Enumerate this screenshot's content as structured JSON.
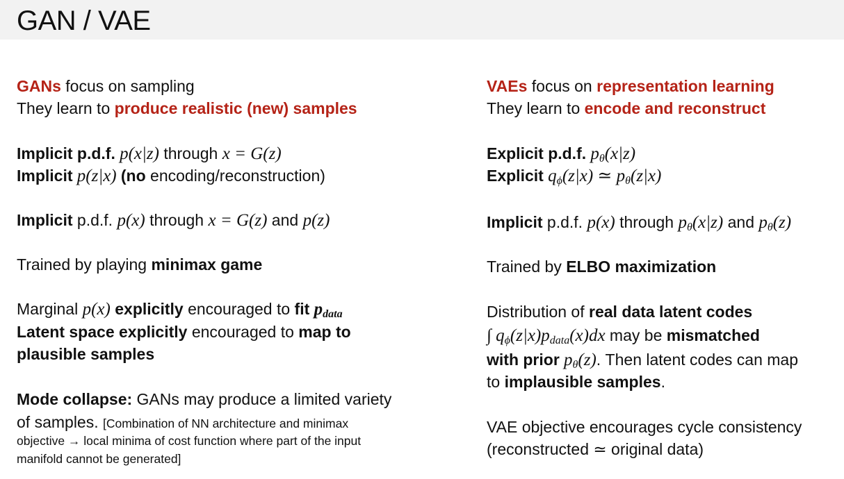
{
  "title": "GAN / VAE",
  "colors": {
    "accent": "#b52317",
    "title_bar": "#f2f2f2",
    "text": "#111111"
  },
  "gan": {
    "l1": {
      "a": "GANs",
      "b": " focus on sampling"
    },
    "l2": {
      "a": "They learn to ",
      "b": "produce realistic (new) samples"
    },
    "l3": {
      "a": "Implicit p.d.f.",
      "b": " p(x|z)",
      "c": " through ",
      "d": "x = G(z)"
    },
    "l4": {
      "a": "Implicit",
      "b": " p(z|x) ",
      "c": "(",
      "d": "no",
      "e": " encoding/reconstruction)"
    },
    "l5": {
      "a": "Implicit",
      "b": " p.d.f. ",
      "c": "p(x)",
      "d": " through ",
      "e": "x = G(z)",
      "f": " and ",
      "g": "p(z)"
    },
    "l6": {
      "a": "Trained by playing ",
      "b": "minimax game"
    },
    "l7": {
      "a": "Marginal ",
      "b": "p(x)",
      "c": " explicitly",
      "d": " encouraged to ",
      "e": "fit ",
      "f": "p",
      "g": "data"
    },
    "l8": {
      "a": "Latent space explicitly",
      "b": " encouraged to ",
      "c": "map to"
    },
    "l9": {
      "a": "plausible samples"
    },
    "l10": {
      "a": "Mode collapse:",
      "b": " GANs may produce a limited variety"
    },
    "l11": {
      "a": "of samples. ",
      "b": "[Combination of NN architecture and minimax"
    },
    "l12": {
      "a": "objective → local minima of cost function where part of the input"
    },
    "l13": {
      "a": "manifold cannot be generated]"
    }
  },
  "vae": {
    "l1": {
      "a": "VAEs",
      "b": " focus on ",
      "c": "representation learning"
    },
    "l2": {
      "a": "They learn to ",
      "b": "encode and reconstruct"
    },
    "l3": {
      "a": "Explicit p.d.f.",
      "b": " p",
      "c": "θ",
      "d": "(x|z)"
    },
    "l4": {
      "a": "Explicit",
      "b": " q",
      "c": "ϕ",
      "d": "(z|x) ≃ p",
      "e": "θ",
      "f": "(z|x)"
    },
    "l5": {
      "a": "Implicit",
      "b": " p.d.f. ",
      "c": "p(x)",
      "d": " through ",
      "e": "p",
      "f": "θ",
      "g": "(x|z)",
      "h": " and ",
      "i": "p",
      "j": "θ",
      "k": "(z)"
    },
    "l6": {
      "a": "Trained by ",
      "b": "ELBO maximization"
    },
    "l7": {
      "a": "Distribution of ",
      "b": "real data latent codes"
    },
    "l8": {
      "a": "∫ q",
      "b": "ϕ",
      "c": "(z|x)p",
      "d": "data",
      "e": "(x)dx",
      "f": " may be ",
      "g": "mismatched"
    },
    "l9": {
      "a": "with prior",
      "b": " p",
      "c": "θ",
      "d": "(z)",
      "e": ". Then latent codes can map"
    },
    "l10": {
      "a": "to ",
      "b": "implausible samples",
      "c": "."
    },
    "l11": {
      "a": "VAE objective encourages cycle consistency"
    },
    "l12": {
      "a": "(reconstructed ≃ original data)"
    }
  }
}
